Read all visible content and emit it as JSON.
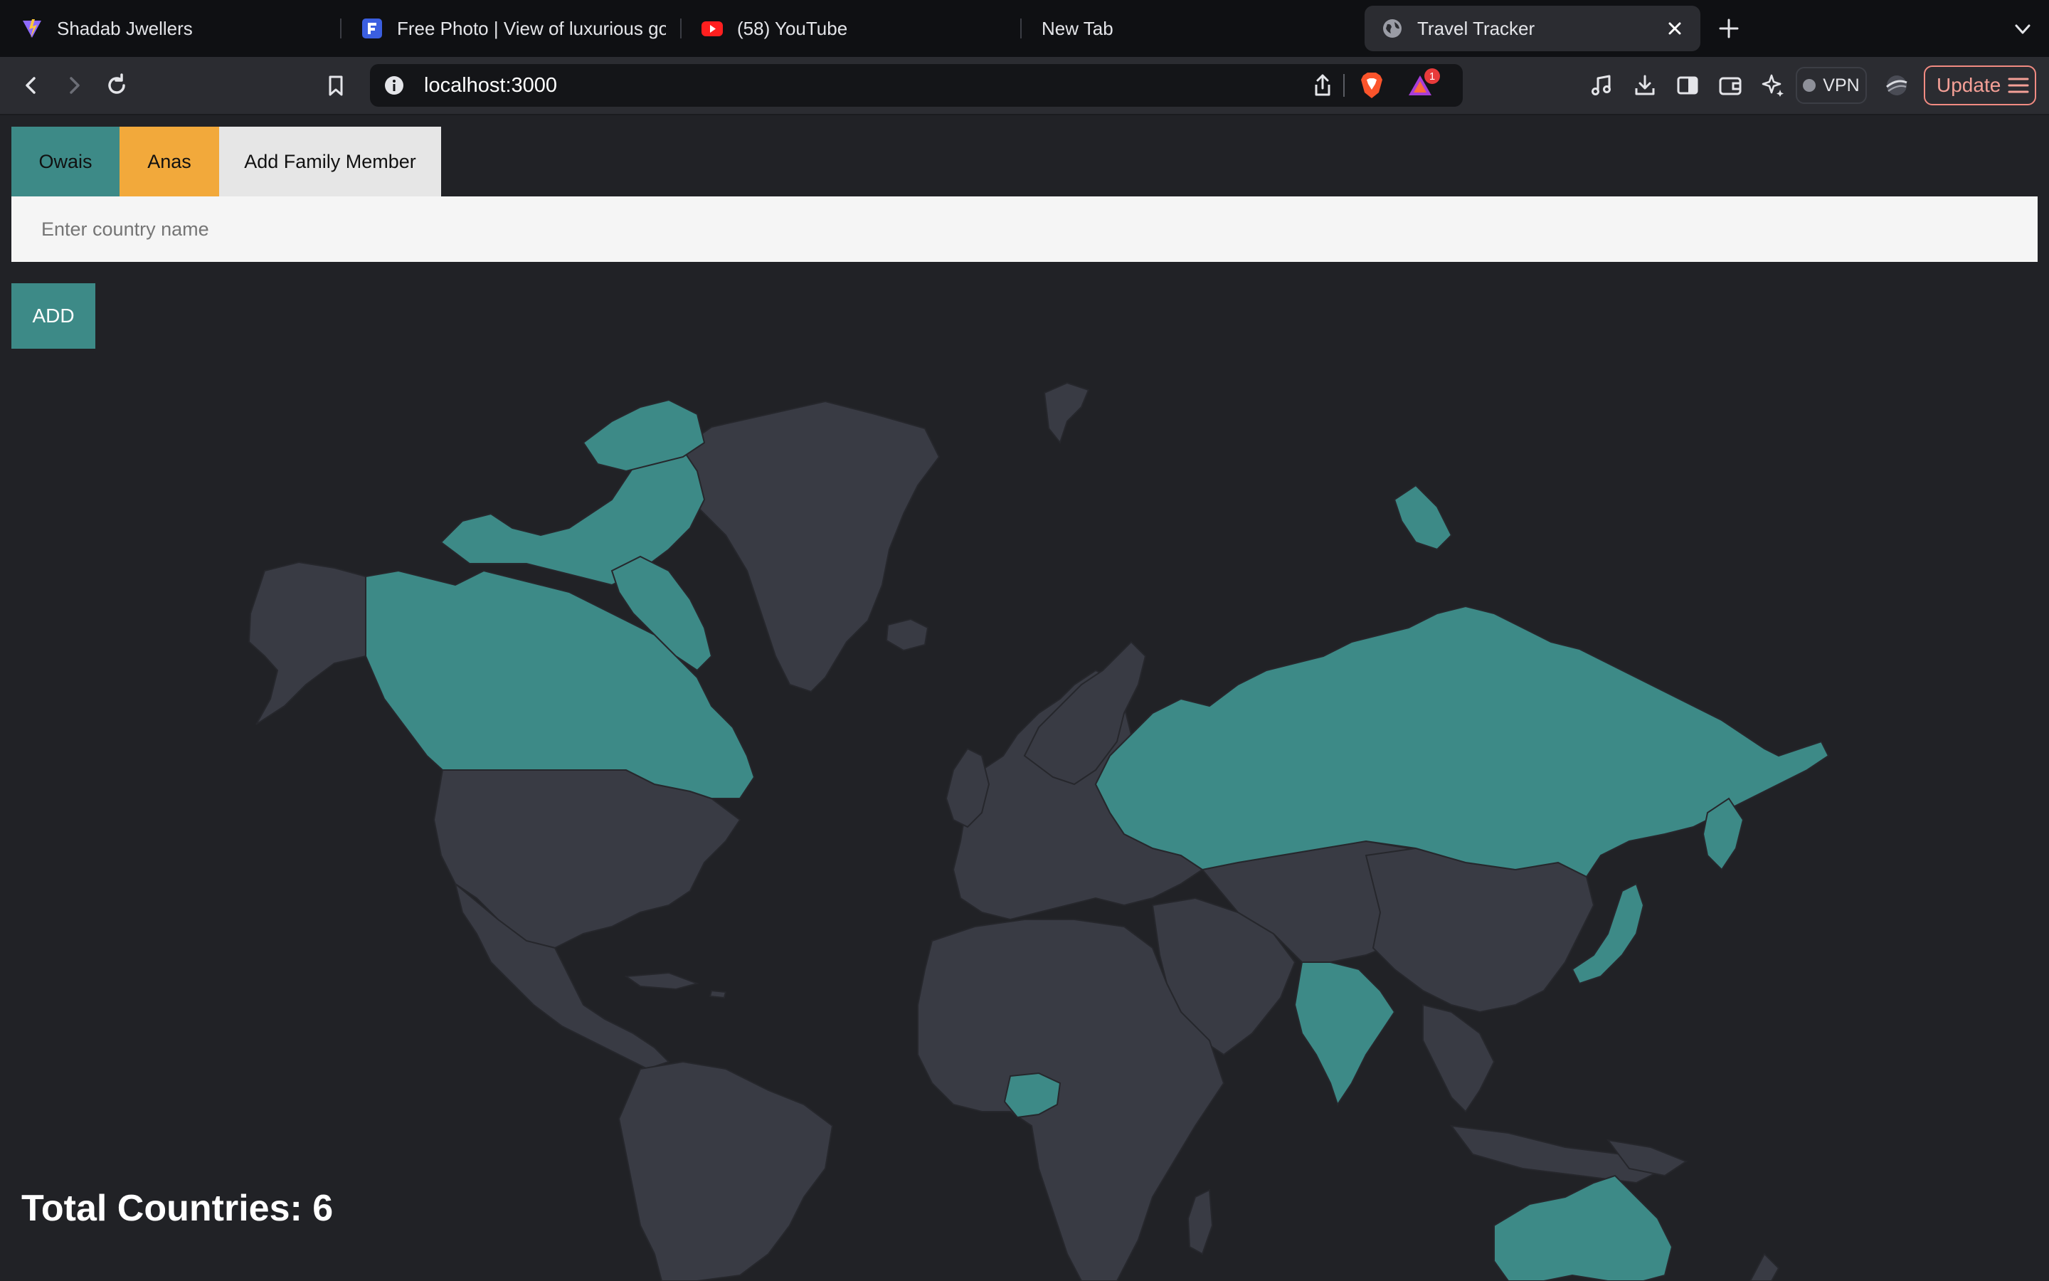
{
  "browser": {
    "tabs": [
      {
        "title": "Shadab Jwellers",
        "icon": "vite-logo-icon",
        "active": false
      },
      {
        "title": "Free Photo | View of luxurious gol",
        "icon": "freepik-icon",
        "active": false
      },
      {
        "title": "(58) YouTube",
        "icon": "youtube-icon",
        "active": false
      },
      {
        "title": "New Tab",
        "icon": "",
        "active": false
      },
      {
        "title": "Travel Tracker",
        "icon": "globe-icon",
        "active": true
      }
    ],
    "url": "localhost:3000",
    "notification_count": "1",
    "vpn_label": "VPN",
    "update_label": "Update"
  },
  "members": [
    {
      "name": "Owais",
      "color": "#3d8a87"
    },
    {
      "name": "Anas",
      "color": "#f2a93b"
    }
  ],
  "add_member_label": "Add Family Member",
  "country_input": {
    "placeholder": "Enter country name",
    "value": ""
  },
  "add_button_label": "ADD",
  "map": {
    "visited_color": "#3d8a87",
    "land_color": "#393b44",
    "border_color": "#26272c",
    "visited_countries": [
      "Canada",
      "Russia",
      "India",
      "Nigeria",
      "Australia",
      "Japan"
    ]
  },
  "total_countries_label": "Total Countries: 6"
}
